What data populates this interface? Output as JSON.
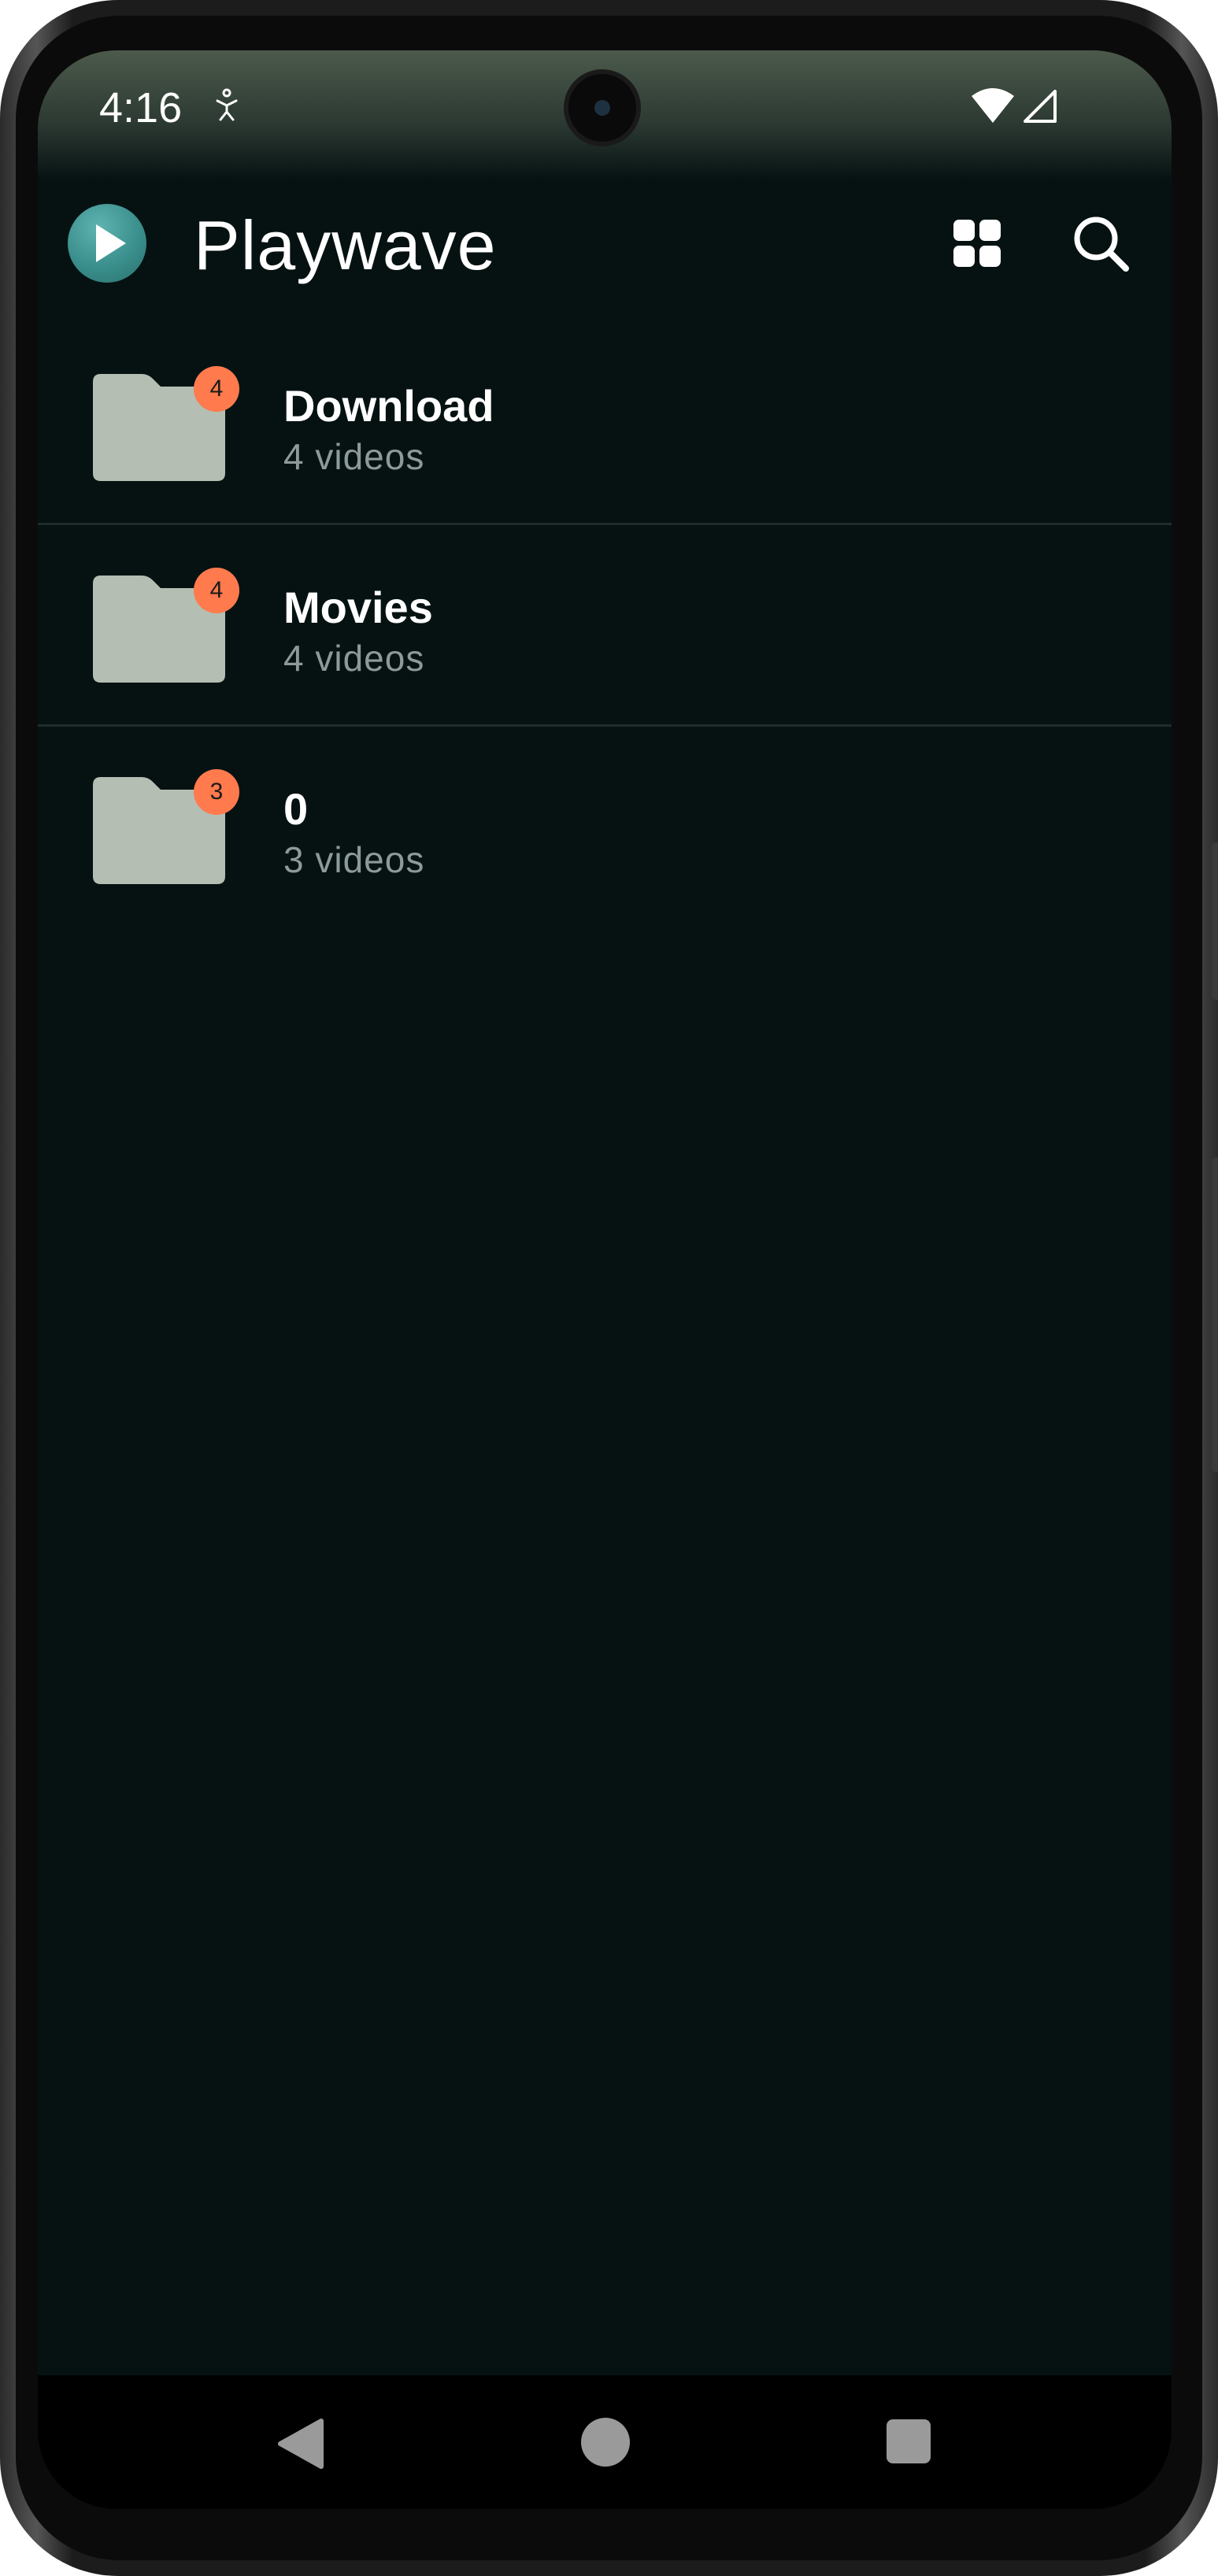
{
  "status_bar": {
    "time": "4:16",
    "icons": [
      "accessibility-icon",
      "wifi-icon",
      "signal-icon"
    ]
  },
  "app_bar": {
    "title": "Playwave",
    "logo_icon": "play-icon",
    "actions": [
      "grid-view-icon",
      "search-icon"
    ]
  },
  "folders": [
    {
      "name": "Download",
      "count_label": "4 videos",
      "badge": "4"
    },
    {
      "name": "Movies",
      "count_label": "4 videos",
      "badge": "4"
    },
    {
      "name": "0",
      "count_label": "3 videos",
      "badge": "3"
    }
  ],
  "nav_bar": {
    "buttons": [
      "back-icon",
      "home-icon",
      "recents-icon"
    ]
  },
  "colors": {
    "background": "#061212",
    "folder": "#b4beb2",
    "badge": "#ff7a4d",
    "subtext": "#8c9a98"
  }
}
